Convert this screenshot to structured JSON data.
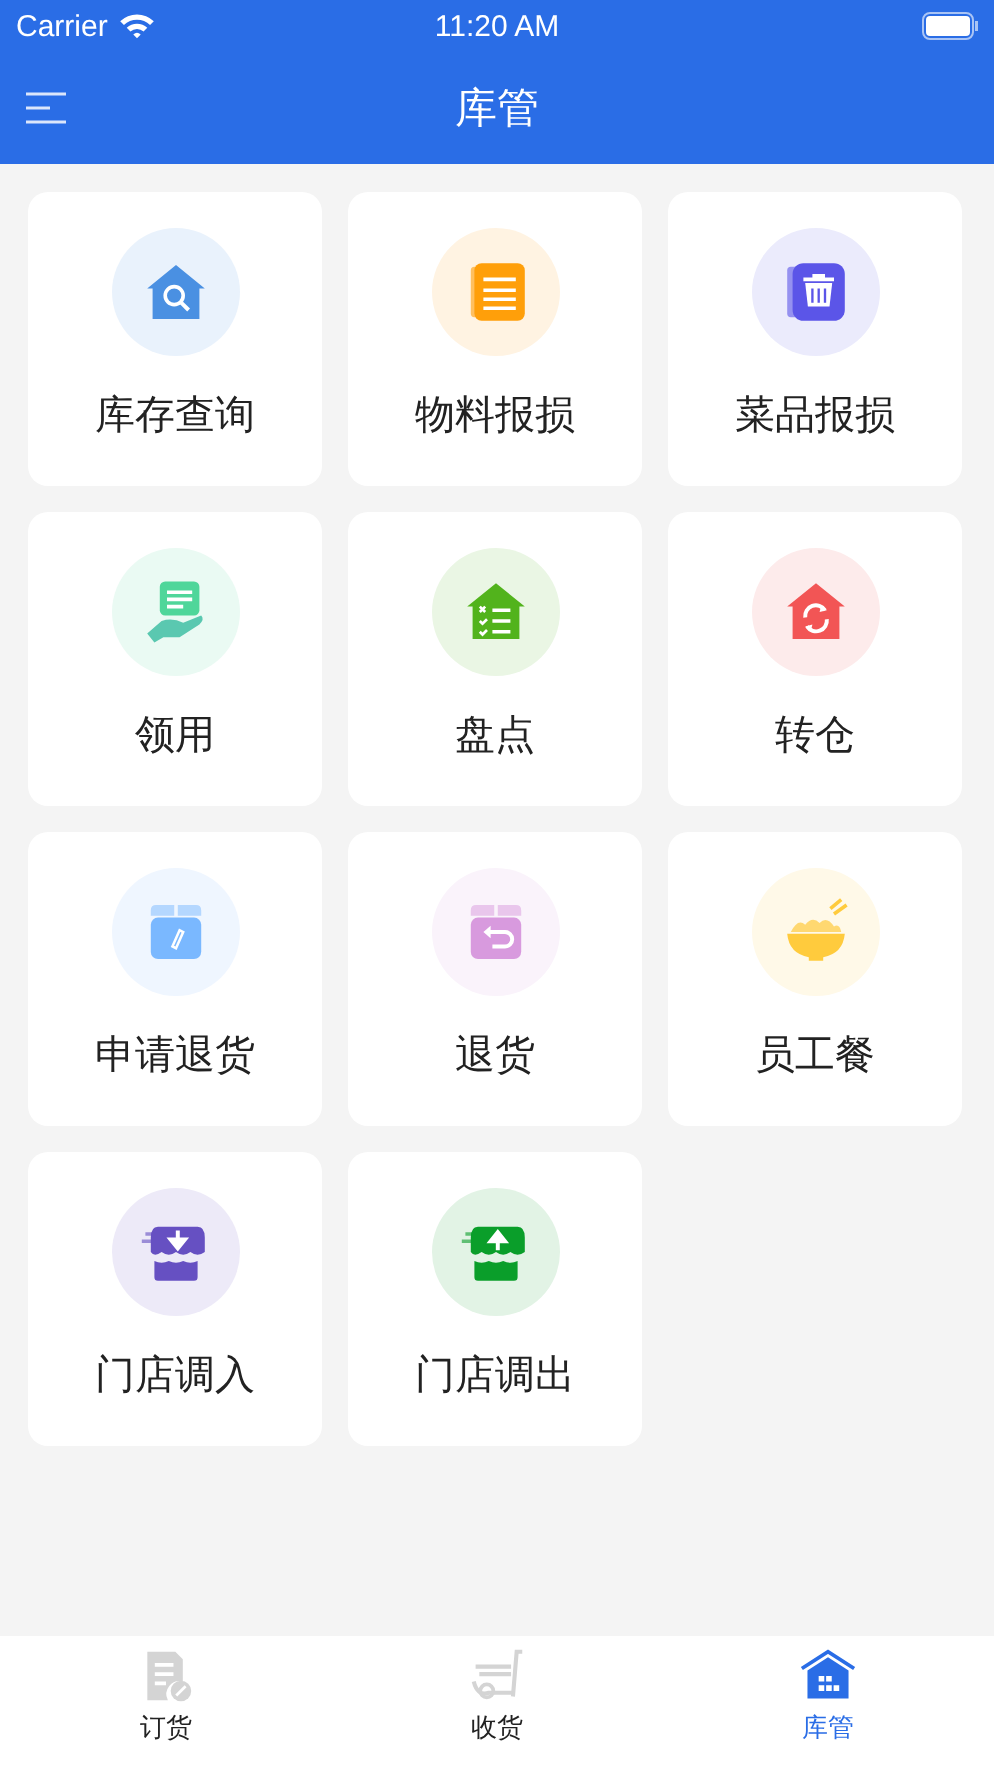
{
  "status_bar": {
    "carrier": "Carrier",
    "time": "11:20 AM"
  },
  "nav_bar": {
    "title": "库管"
  },
  "tiles": [
    {
      "label": "库存查询",
      "kind": "house-search",
      "color": "#4a90e2"
    },
    {
      "label": "物料报损",
      "kind": "document",
      "color": "#ff9f0a"
    },
    {
      "label": "菜品报损",
      "kind": "trash",
      "color": "#5b55e8"
    },
    {
      "label": "领用",
      "kind": "hand-note",
      "color": "#4fd69a"
    },
    {
      "label": "盘点",
      "kind": "house-list",
      "color": "#52b31c"
    },
    {
      "label": "转仓",
      "kind": "house-refresh",
      "color": "#f25555"
    },
    {
      "label": "申请退货",
      "kind": "box-pen",
      "color": "#7ab8ff"
    },
    {
      "label": "退货",
      "kind": "box-return",
      "color": "#d89ade"
    },
    {
      "label": "员工餐",
      "kind": "bowl",
      "color": "#ffcb3d"
    },
    {
      "label": "门店调入",
      "kind": "store-in",
      "color": "#6650c2"
    },
    {
      "label": "门店调出",
      "kind": "store-out",
      "color": "#0a9e2a"
    }
  ],
  "tab_bar": [
    {
      "label": "订货",
      "kind": "order",
      "selected": false
    },
    {
      "label": "收货",
      "kind": "cart",
      "selected": false
    },
    {
      "label": "库管",
      "kind": "warehouse",
      "selected": true
    }
  ]
}
